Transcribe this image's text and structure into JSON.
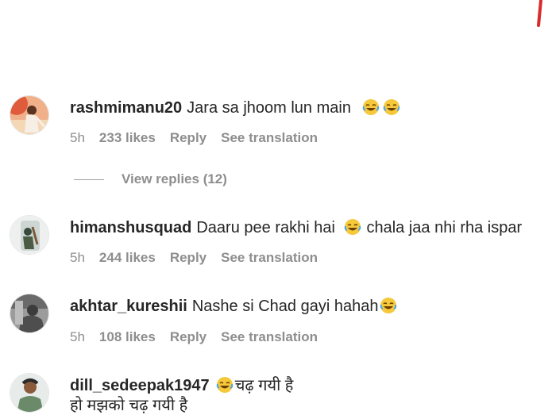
{
  "accent": {
    "red_mark": "#d82b2b",
    "meta_gray": "#8e8e8e",
    "text": "#262626"
  },
  "comments": [
    {
      "username": "rashmimanu20",
      "text": "Jara sa jhoom lun main",
      "emoji": [
        "laughing-face-icon",
        "laughing-face-icon"
      ],
      "time": "5h",
      "likes": "233 likes",
      "reply": "Reply",
      "translate": "See translation",
      "view_replies": "View replies (12)"
    },
    {
      "username": "himanshusquad",
      "text_before": "Daaru pee rakhi hai",
      "text_after": "chala jaa nhi rha ispar",
      "emoji": [
        "laughing-face-icon"
      ],
      "time": "5h",
      "likes": "244 likes",
      "reply": "Reply",
      "translate": "See translation"
    },
    {
      "username": "akhtar_kureshii",
      "text": "Nashe si Chad gayi hahah",
      "emoji": [
        "laughing-face-icon"
      ],
      "time": "5h",
      "likes": "108 likes",
      "reply": "Reply",
      "translate": "See translation"
    },
    {
      "username": "dill_sedeepak1947",
      "text": "चढ़ गयी है",
      "text_line2": "हो मझको चढ़ गयी है",
      "emoji": [
        "laughing-face-icon"
      ]
    }
  ]
}
